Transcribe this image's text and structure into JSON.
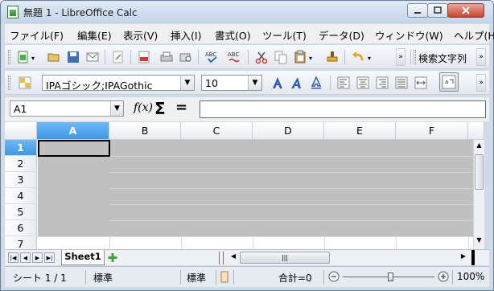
{
  "window": {
    "title": "無題 1 - LibreOffice Calc"
  },
  "menu": [
    "ファイル(F)",
    "編集(E)",
    "表示(V)",
    "挿入(I)",
    "書式(O)",
    "ツール(T)",
    "データ(D)",
    "ウィンドウ(W)",
    "ヘルプ(H)"
  ],
  "toolbar": {
    "search_label": "検索文字列"
  },
  "formatting": {
    "font_name": "IPAゴシック;IPAGothic",
    "font_size": "10"
  },
  "formula": {
    "cell_ref": "A1",
    "function_wizard": "f(x)",
    "sum": "Σ",
    "equals": "=",
    "value": ""
  },
  "grid": {
    "columns": [
      "A",
      "B",
      "C",
      "D",
      "E",
      "F"
    ],
    "rows": [
      "1",
      "2",
      "3",
      "4",
      "5",
      "6",
      "7"
    ],
    "selected_column": "A",
    "selected_row": "1"
  },
  "sheets": {
    "tabs": [
      "Sheet1"
    ],
    "active": "Sheet1",
    "scroll_thumb": "|||"
  },
  "status": {
    "sheet": "シート 1 / 1",
    "page_style": "標準",
    "mode": "標準",
    "sum": "合計=0",
    "zoom": "100%"
  },
  "colors": {
    "accent": "#3f97e4",
    "window_frame": "#cfdbe9",
    "selection_fill": "#c0c0c0"
  }
}
